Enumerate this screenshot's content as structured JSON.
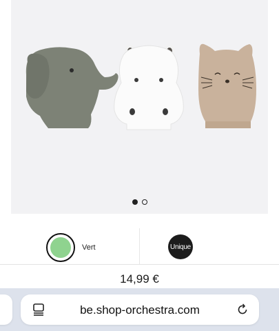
{
  "gallery": {
    "product_image": "three animal bath mitts: elephant, hippo, cat",
    "pagination": {
      "current": 1,
      "total": 2
    }
  },
  "variants": {
    "color": {
      "label": "Vert",
      "swatch_color": "#8fd38f"
    },
    "size": {
      "label": "Unique"
    }
  },
  "price": "14,99 €",
  "browser": {
    "url": "be.shop-orchestra.com",
    "tabs_icon": "tabs-icon",
    "reload_icon": "reload-icon"
  }
}
